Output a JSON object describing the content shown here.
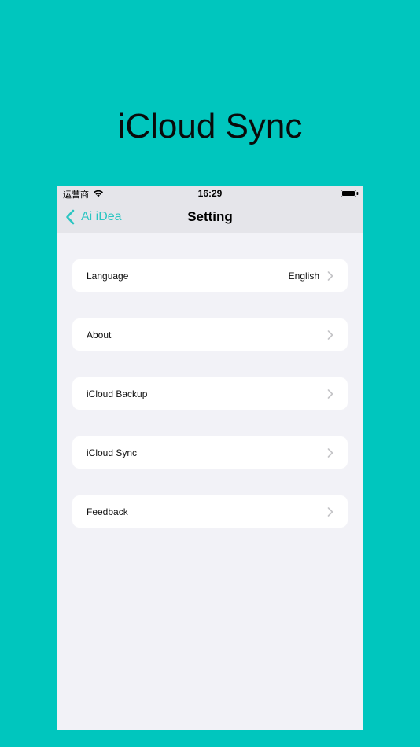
{
  "headline": "iCloud Sync",
  "status_bar": {
    "carrier": "运营商",
    "time": "16:29"
  },
  "nav": {
    "back_label": "Ai iDea",
    "title": "Setting"
  },
  "settings": [
    {
      "label": "Language",
      "value": "English"
    },
    {
      "label": "About",
      "value": ""
    },
    {
      "label": "iCloud Backup",
      "value": ""
    },
    {
      "label": "iCloud Sync",
      "value": ""
    },
    {
      "label": "Feedback",
      "value": ""
    }
  ],
  "colors": {
    "page_background": "#00C6BE",
    "accent": "#2BC5C2",
    "list_background": "#F2F2F7",
    "navbar_background": "#E5E5EA"
  },
  "icons": [
    "wifi-icon",
    "battery-icon",
    "back-chevron-icon",
    "chevron-right-icon"
  ]
}
